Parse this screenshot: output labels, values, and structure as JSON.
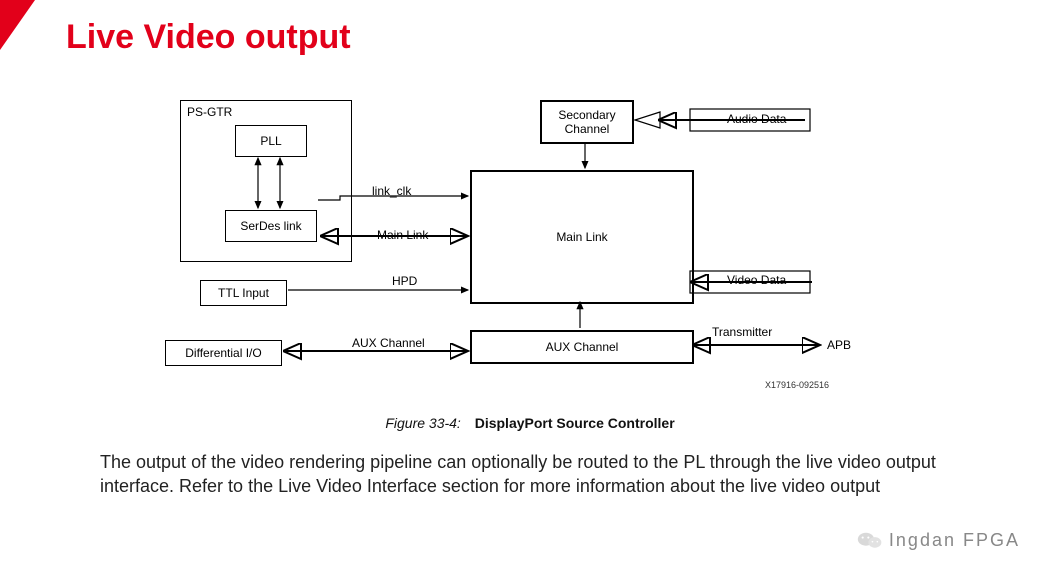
{
  "title": "Live Video output",
  "diagram": {
    "ps_gtr_label": "PS-GTR",
    "blocks": {
      "pll": "PLL",
      "serdes": "SerDes link",
      "ttl": "TTL Input",
      "diffio": "Differential I/O",
      "secondary": "Secondary\nChannel",
      "mainlink": "Main Link",
      "auxchan": "AUX Channel"
    },
    "wires": {
      "link_clk": "link_clk",
      "main_link": "Main Link",
      "hpd": "HPD",
      "aux_channel": "AUX Channel",
      "transmitter": "Transmitter",
      "audio_data": "Audio Data",
      "video_data": "Video Data",
      "apb": "APB"
    },
    "doc_id": "X17916-092516"
  },
  "figure_caption": {
    "prefix": "Figure 33-4:",
    "text": "DisplayPort Source Controller"
  },
  "body": "The output of the video rendering pipeline can optionally be routed to the PL through the live video output interface. Refer to the Live Video Interface section for more information about the live video output",
  "watermark": "Ingdan FPGA"
}
